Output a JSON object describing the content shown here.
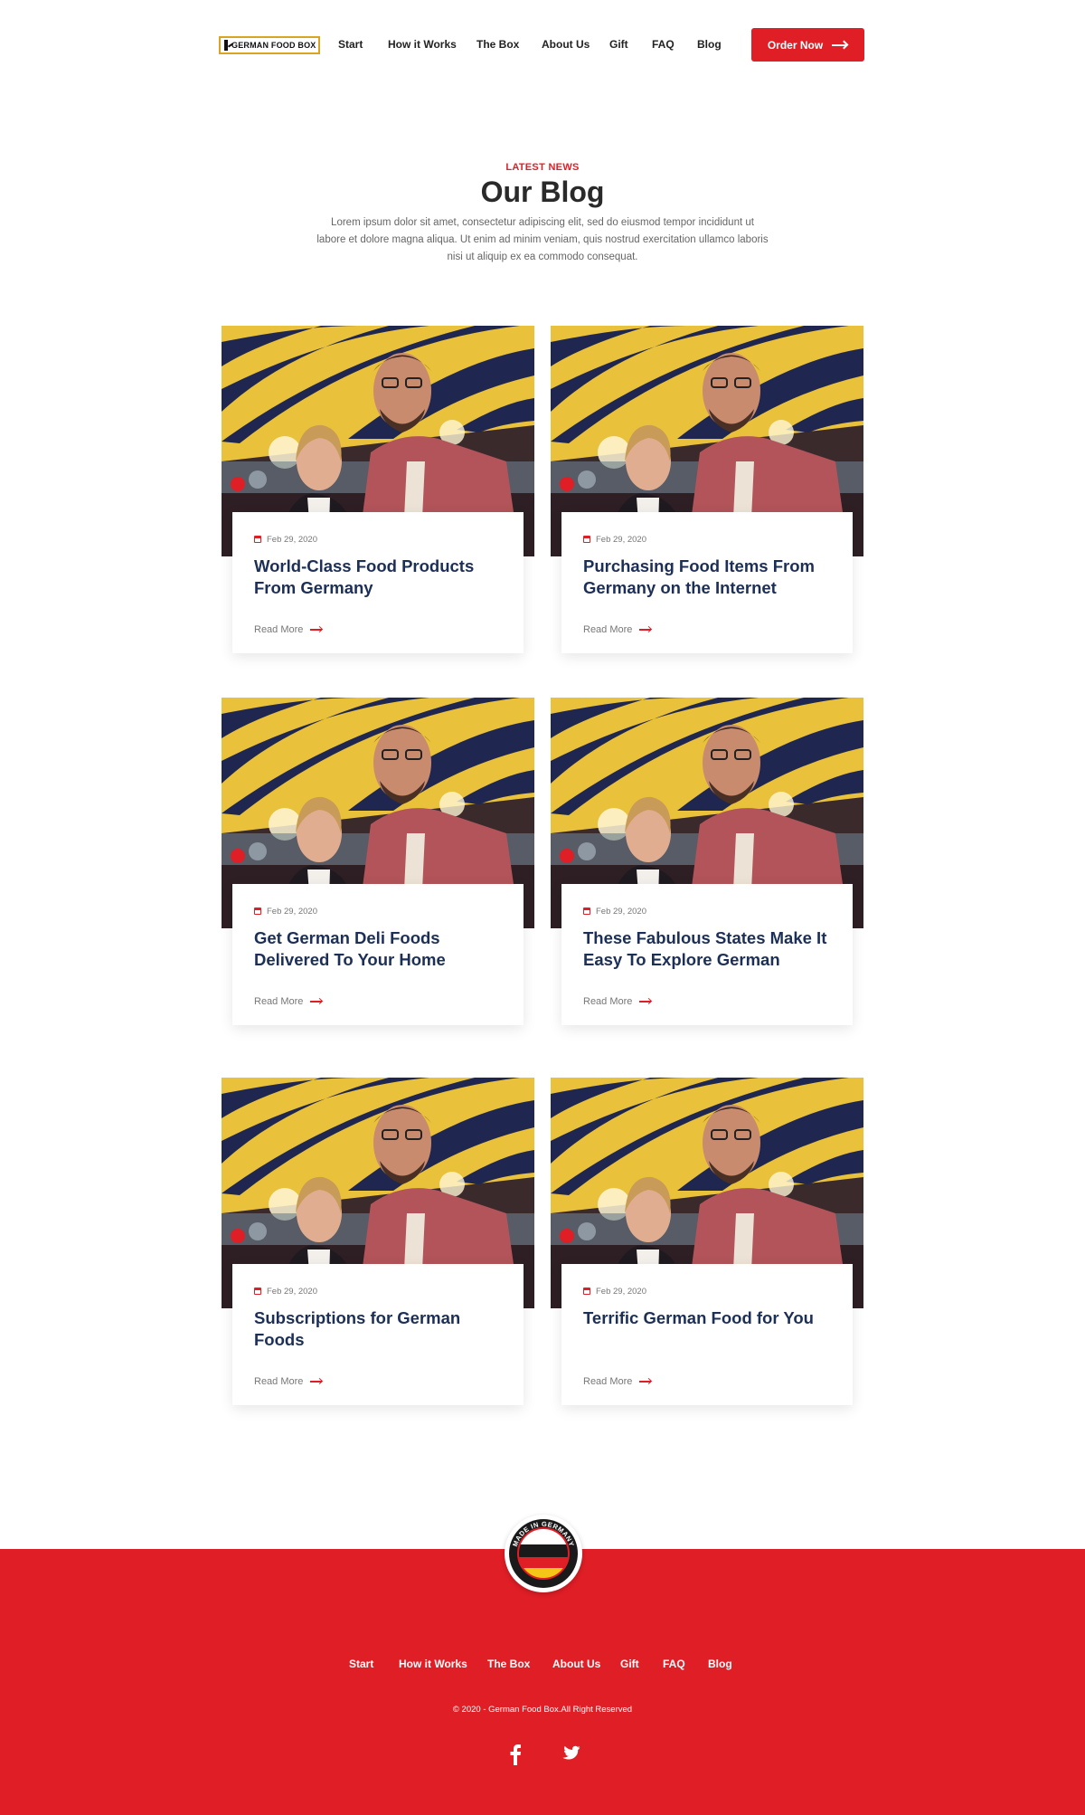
{
  "header": {
    "logo_text": "GERMAN FOOD BOX",
    "nav": [
      "Start",
      "How it Works",
      "The Box",
      "About Us",
      "Gift",
      "FAQ",
      "Blog"
    ],
    "cta_label": "Order Now"
  },
  "section": {
    "eyebrow": "LATEST NEWS",
    "title": "Our Blog",
    "intro": "Lorem ipsum dolor sit amet, consectetur adipiscing elit, sed do eiusmod tempor incididunt ut labore et dolore magna aliqua. Ut enim ad minim veniam, quis nostrud exercitation ullamco laboris nisi ut aliquip ex ea commodo consequat."
  },
  "posts": [
    {
      "date": "Feb 29, 2020",
      "title": "World-Class Food Products From Germany",
      "link": "Read More"
    },
    {
      "date": "Feb 29, 2020",
      "title": "Purchasing Food Items From Germany on the Internet",
      "link": "Read More"
    },
    {
      "date": "Feb 29, 2020",
      "title": "Get German Deli Foods Delivered To Your Home",
      "link": "Read More"
    },
    {
      "date": "Feb 29, 2020",
      "title": "These Fabulous States Make It Easy To Explore German",
      "link": "Read More"
    },
    {
      "date": "Feb 29, 2020",
      "title": "Subscriptions for German Foods",
      "link": "Read More"
    },
    {
      "date": "Feb 29, 2020",
      "title": "Terrific German Food for You",
      "link": "Read More"
    }
  ],
  "footer": {
    "badge_text": "MADE IN GERMANY",
    "nav": [
      "Start",
      "How it Works",
      "The Box",
      "About Us",
      "Gift",
      "FAQ",
      "Blog"
    ],
    "copyright": "© 2020 - German Food Box.All Right Reserved",
    "social": [
      "facebook-icon",
      "twitter-icon"
    ]
  },
  "colors": {
    "accent": "#e01e26",
    "title": "#1c2f57",
    "logo_border": "#d9a421"
  }
}
